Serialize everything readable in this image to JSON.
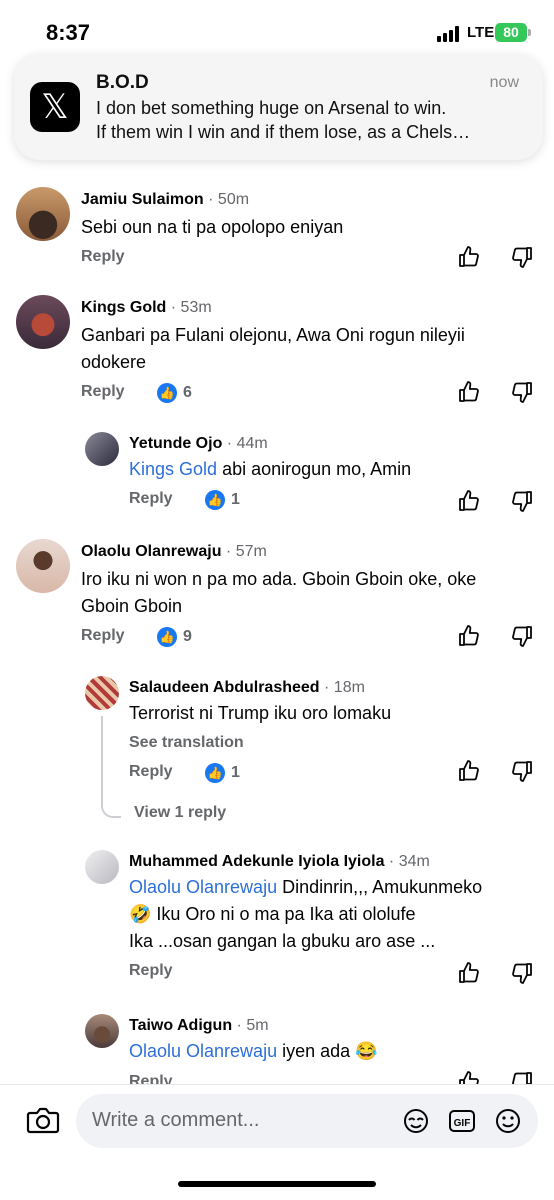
{
  "status": {
    "time": "8:37",
    "network": "LTE",
    "battery": "80"
  },
  "notification": {
    "app_icon": "x-logo-icon",
    "title": "B.O.D",
    "time": "now",
    "line1": "I don bet something huge on Arsenal to win.",
    "line2": "If them win I win and if them lose, as a Chels…"
  },
  "comments": [
    {
      "name": "Jamiu Sulaimon",
      "time": "50m",
      "text": "Sebi oun na ti pa opolopo eniyan",
      "reply": "Reply"
    },
    {
      "name": "Kings Gold",
      "time": "53m",
      "text1": "Ganbari pa Fulani olejonu, Awa Oni rogun nileyii",
      "text2": "odokere",
      "reply": "Reply",
      "likes": "6"
    },
    {
      "name": "Yetunde Ojo",
      "time": "44m",
      "mention": "Kings Gold",
      "text": " abi aonirogun mo, Amin",
      "reply": "Reply",
      "likes": "1"
    },
    {
      "name": "Olaolu Olanrewaju",
      "time": "57m",
      "text1": "Iro iku ni won n pa mo ada. Gboin Gboin oke, oke",
      "text2": "Gboin Gboin",
      "reply": "Reply",
      "likes": "9"
    },
    {
      "name": "Salaudeen Abdulrasheed",
      "time": "18m",
      "text": "Terrorist ni Trump iku oro lomaku",
      "see_translation": "See translation",
      "reply": "Reply",
      "likes": "1",
      "view_replies": "View 1 reply"
    },
    {
      "name": "Muhammed Adekunle Iyiola Iyiola",
      "time": "34m",
      "mention": "Olaolu Olanrewaju",
      "text1": " Dindinrin,,, Amukunmeko",
      "text2": "🤣 Iku Oro ni o ma pa Ika ati ololufe",
      "text3": "Ika ...osan gangan la gbuku aro ase ...",
      "reply": "Reply"
    },
    {
      "name": "Taiwo Adigun",
      "time": "5m",
      "mention": "Olaolu Olanrewaju",
      "text": " iyen ada 😂",
      "reply": "Reply"
    }
  ],
  "composer": {
    "placeholder": "Write a comment...",
    "icons": [
      "camera-icon",
      "avatar-sticker-icon",
      "gif-icon",
      "emoji-icon"
    ]
  }
}
